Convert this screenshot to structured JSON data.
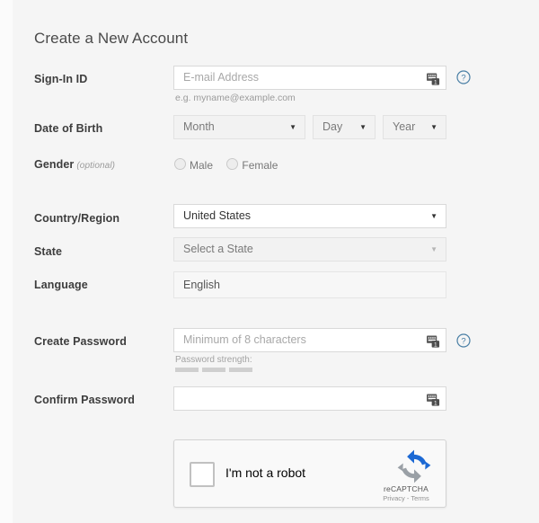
{
  "page": {
    "title": "Create a New Account",
    "background_color": "#f5f5f5"
  },
  "colors": {
    "accent_help": "#4a7fa5",
    "recaptcha_blue": "#1c69d4",
    "recaptcha_gray": "#9aa0a6",
    "field_border": "#d9d9d9",
    "label_text": "#3d3d3d",
    "placeholder_text": "#a8a8a8"
  },
  "fields": {
    "signin": {
      "label": "Sign-In ID",
      "placeholder": "E-mail Address",
      "value": "",
      "hint": "e.g. myname@example.com",
      "icon": "password-manager-icon",
      "help_icon": "help-circle-icon"
    },
    "dob": {
      "label": "Date of Birth",
      "month": {
        "placeholder": "Month",
        "value": ""
      },
      "day": {
        "placeholder": "Day",
        "value": ""
      },
      "year": {
        "placeholder": "Year",
        "value": ""
      }
    },
    "gender": {
      "label": "Gender",
      "optional": "(optional)",
      "options": [
        {
          "label": "Male",
          "selected": false
        },
        {
          "label": "Female",
          "selected": false
        }
      ]
    },
    "country": {
      "label": "Country/Region",
      "value": "United States"
    },
    "state": {
      "label": "State",
      "placeholder": "Select a State",
      "value": ""
    },
    "language": {
      "label": "Language",
      "value": "English"
    },
    "password": {
      "label": "Create Password",
      "placeholder": "Minimum of 8 characters",
      "value": "",
      "strength_label": "Password strength:",
      "strength_segments": 3,
      "strength_filled": 0,
      "icon": "password-manager-icon",
      "help_icon": "help-circle-icon"
    },
    "confirm_password": {
      "label": "Confirm Password",
      "placeholder": "",
      "value": "",
      "icon": "password-manager-icon"
    }
  },
  "recaptcha": {
    "checkbox_label": "I'm not a robot",
    "checked": false,
    "brand": "reCAPTCHA",
    "legal": "Privacy - Terms",
    "logo_icon": "recaptcha-logo-icon"
  }
}
